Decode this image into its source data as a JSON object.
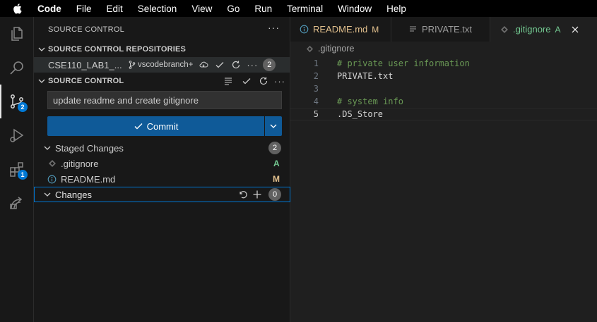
{
  "menubar": {
    "items": [
      "Code",
      "File",
      "Edit",
      "Selection",
      "View",
      "Go",
      "Run",
      "Terminal",
      "Window",
      "Help"
    ]
  },
  "activity_bar": {
    "items": [
      {
        "icon": "files-icon"
      },
      {
        "icon": "search-icon"
      },
      {
        "icon": "source-control-icon",
        "badge": "2"
      },
      {
        "icon": "run-debug-icon"
      },
      {
        "icon": "extensions-icon",
        "badge": "1"
      },
      {
        "icon": "remote-explorer-icon"
      }
    ]
  },
  "sidebar": {
    "title": "SOURCE CONTROL",
    "more": "···",
    "repositories": {
      "header": "SOURCE CONTROL REPOSITORIES",
      "repo_name": "CSE110_LAB1_...",
      "branch": "vscodebranch+",
      "count": "2"
    },
    "source_control": {
      "header": "SOURCE CONTROL",
      "message": "update readme and create gitignore",
      "commit_label": "Commit"
    },
    "staged": {
      "label": "Staged Changes",
      "count": "2",
      "files": [
        {
          "name": ".gitignore",
          "status": "A",
          "status_color": "#73c991"
        },
        {
          "name": "README.md",
          "status": "M",
          "status_color": "#e2c08d"
        }
      ]
    },
    "changes": {
      "label": "Changes",
      "count": "0"
    }
  },
  "editor": {
    "tabs": [
      {
        "name": "README.md",
        "status": "M",
        "color": "#e2c08d"
      },
      {
        "name": "PRIVATE.txt",
        "status": "",
        "color": "#9d9d9d"
      },
      {
        "name": ".gitignore",
        "status": "A",
        "color": "#73c991"
      }
    ],
    "breadcrumb": ".gitignore",
    "lines": [
      {
        "n": "1",
        "text": "# private user information",
        "kind": "comment"
      },
      {
        "n": "2",
        "text": "PRIVATE.txt",
        "kind": "plain"
      },
      {
        "n": "3",
        "text": "",
        "kind": "plain"
      },
      {
        "n": "4",
        "text": "# system info",
        "kind": "comment"
      },
      {
        "n": "5",
        "text": ".DS_Store",
        "kind": "plain"
      }
    ]
  },
  "colors": {
    "accent": "#0078d4",
    "commit_button": "#0f5a98",
    "added": "#73c991",
    "modified": "#e2c08d",
    "comment": "#6a9955"
  }
}
